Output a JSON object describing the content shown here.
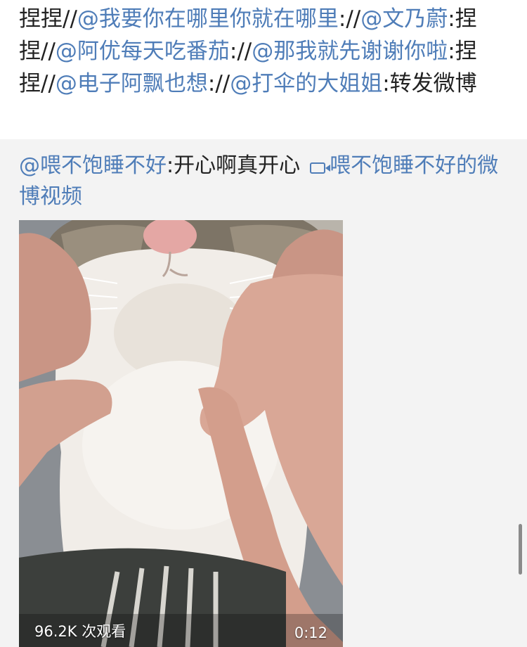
{
  "repost": {
    "segments": [
      {
        "text": "捏捏//",
        "type": "text"
      },
      {
        "text": "@我要你在哪里你就在哪里",
        "type": "mention"
      },
      {
        "text": "://",
        "type": "text"
      },
      {
        "text": "@文乃蔚",
        "type": "mention"
      },
      {
        "text": ":捏捏//",
        "type": "text"
      },
      {
        "text": "@阿优每天吃番茄",
        "type": "mention"
      },
      {
        "text": "://",
        "type": "text"
      },
      {
        "text": "@那我就先谢谢你啦",
        "type": "mention"
      },
      {
        "text": ":捏捏//",
        "type": "text"
      },
      {
        "text": "@电子阿飘也想",
        "type": "mention"
      },
      {
        "text": "://",
        "type": "text"
      },
      {
        "text": "@打伞的大姐姐",
        "type": "mention"
      },
      {
        "text": ":转发微博",
        "type": "text"
      }
    ]
  },
  "original": {
    "author": "@喂不饱睡不好",
    "content": ":开心啊真开心",
    "video_link_label": "喂不饱睡不好的微博视频",
    "video_link_icon": "video-camera-icon"
  },
  "video": {
    "views": "96.2K 次观看",
    "duration": "0:12"
  },
  "colors": {
    "mention": "#4f7db8",
    "text": "#222222",
    "card_background": "#f3f3f3"
  }
}
